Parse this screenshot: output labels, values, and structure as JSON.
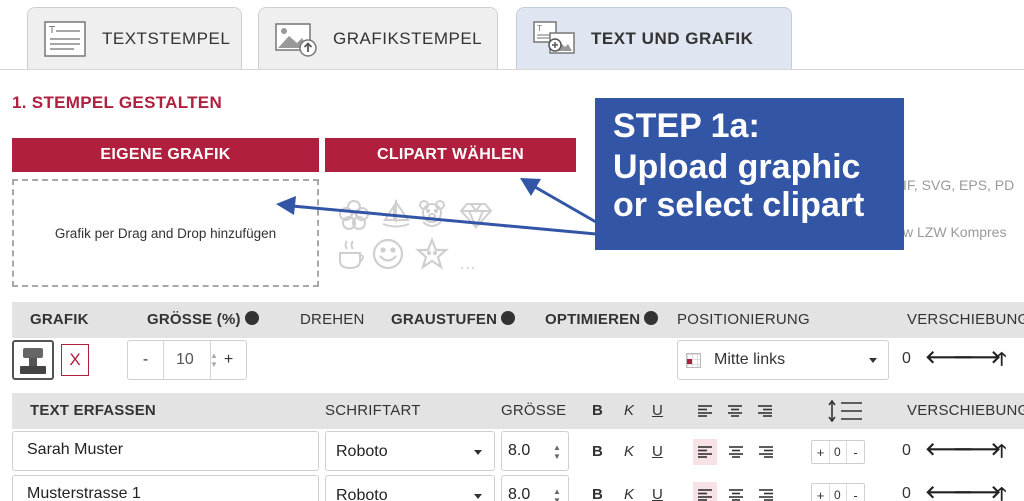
{
  "tabs": [
    {
      "label": "TEXTSTEMPEL",
      "icon": "text-stamp-icon"
    },
    {
      "label": "GRAFIKSTEMPEL",
      "icon": "image-stamp-icon"
    },
    {
      "label": "TEXT UND GRAFIK",
      "icon": "text-image-stamp-icon",
      "active": true
    }
  ],
  "section_title": "1. STEMPEL GESTALTEN",
  "buttons": {
    "own_graphic": "EIGENE GRAFIK",
    "clipart": "CLIPART WÄHLEN"
  },
  "dropzone_text": "Grafik per Drag and Drop hinzufügen",
  "clipart_more": "...",
  "background_text": {
    "formats": "IF, SVG, EPS, PD",
    "compression": "w LZW Kompres"
  },
  "callout": {
    "title": "STEP 1a:",
    "line1": "Upload graphic",
    "line2": "or select clipart"
  },
  "grafik_header": {
    "grafik": "GRAFIK",
    "groesse": "GRÖSSE (%)",
    "drehen": "DREHEN",
    "graustufen": "GRAUSTUFEN",
    "optimieren": "OPTIMIEREN",
    "positionierung": "POSITIONIERUNG",
    "verschiebung": "VERSCHIEBUNG"
  },
  "info_glyph": "i",
  "grafik_row": {
    "remove_label": "X",
    "minus": "-",
    "plus": "+",
    "size_value": "10",
    "position_value": "Mitte links",
    "shift_value": "0",
    "arrow_left": "🡐",
    "arrow_right": "🡒",
    "arrow_up": "🡑"
  },
  "text_header": {
    "text": "TEXT ERFASSEN",
    "font": "SCHRIFTART",
    "size": "GRÖSSE",
    "bold": "B",
    "italic": "K",
    "underline": "U",
    "verschiebung": "VERSCHIEBUNG"
  },
  "text_rows": [
    {
      "text": "Sarah Muster",
      "font": "Roboto",
      "size": "8.0",
      "bold": "B",
      "italic": "K",
      "underline": "U",
      "ls_plus": "+",
      "ls_value": "0",
      "ls_minus": "-",
      "shift": "0"
    },
    {
      "text": "Musterstrasse 1",
      "font": "Roboto",
      "size": "8.0",
      "bold": "B",
      "italic": "K",
      "underline": "U",
      "ls_plus": "+",
      "ls_value": "0",
      "ls_minus": "-",
      "shift": "0"
    }
  ],
  "colors": {
    "accent_red": "#b0203e",
    "callout_blue": "#3355a6",
    "header_gray": "#e3e3e3",
    "tab_active": "#dfe5f1"
  }
}
